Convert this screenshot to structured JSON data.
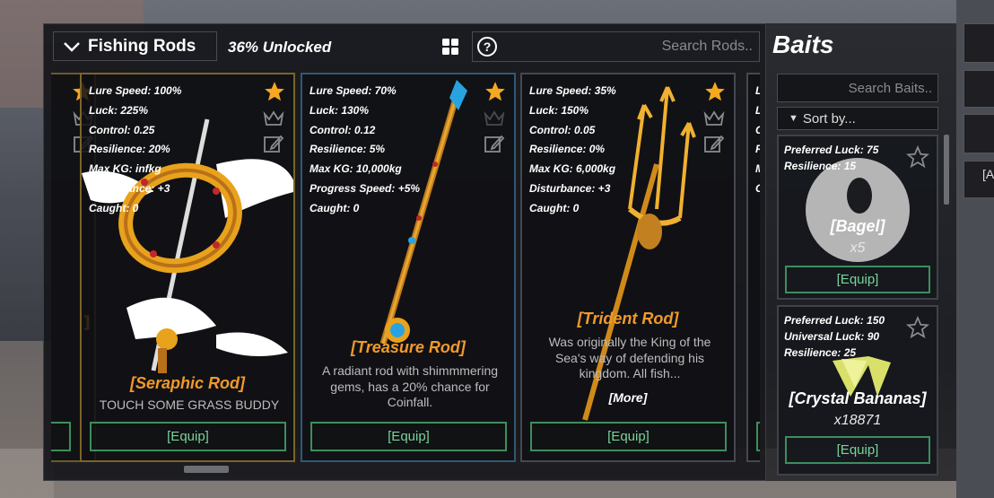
{
  "rods": {
    "dropdown_label": "Fishing Rods",
    "unlocked_text": "36% Unlocked",
    "search_placeholder": "Search Rods..",
    "equip_label": "[Equip]",
    "cards": [
      {
        "name": "[Seraphic Rod]",
        "stats": [
          "Lure Speed: 100%",
          "Luck: 225%",
          "Control: 0.25",
          "Resilience: 20%",
          "Max KG: infkg",
          "Disturbance: +3",
          "Caught: 0"
        ],
        "description": "TOUCH SOME GRASS BUDDY",
        "more": ""
      },
      {
        "name": "[Treasure Rod]",
        "stats": [
          "Lure Speed: 70%",
          "Luck: 130%",
          "Control: 0.12",
          "Resilience: 5%",
          "Max KG: 10,000kg",
          "Progress Speed: +5%",
          "Caught: 0"
        ],
        "description": "A radiant rod with shimmmering gems, has a 20% chance for Coinfall.",
        "more": ""
      },
      {
        "name": "[Trident Rod]",
        "stats": [
          "Lure Speed: 35%",
          "Luck: 150%",
          "Control: 0.05",
          "Resilience: 0%",
          "Max KG: 6,000kg",
          "Disturbance: +3",
          "Caught: 0"
        ],
        "description": "Was originally the King of the Sea's way of defending his kingdom. All fish...",
        "more": "[More]"
      }
    ],
    "partial_right_stats": [
      "Lu",
      "Lu",
      "Co",
      "Re",
      "M",
      "Co"
    ]
  },
  "baits": {
    "title": "Baits",
    "search_placeholder": "Search Baits..",
    "sort_label": "Sort by...",
    "equip_label": "[Equip]",
    "cards": [
      {
        "name": "[Bagel]",
        "quantity": "x5",
        "stats": [
          "Preferred Luck: 75",
          "Resilience: 15"
        ]
      },
      {
        "name": "[Crystal Bananas]",
        "quantity": "x18871",
        "stats": [
          "Preferred Luck: 150",
          "Universal Luck: 90",
          "Resilience: 25"
        ]
      }
    ]
  },
  "side": {
    "partial_button_label": "[A"
  },
  "colors": {
    "rod_name": "#f19a2a",
    "equip_border": "#3d8e5e",
    "equip_text": "#79d39a",
    "star_gold": "#f6a81e"
  },
  "icons": [
    "chevron-down-icon",
    "grid-icon",
    "help-icon",
    "star-icon",
    "crown-icon",
    "edit-icon",
    "sort-triangle-icon"
  ]
}
